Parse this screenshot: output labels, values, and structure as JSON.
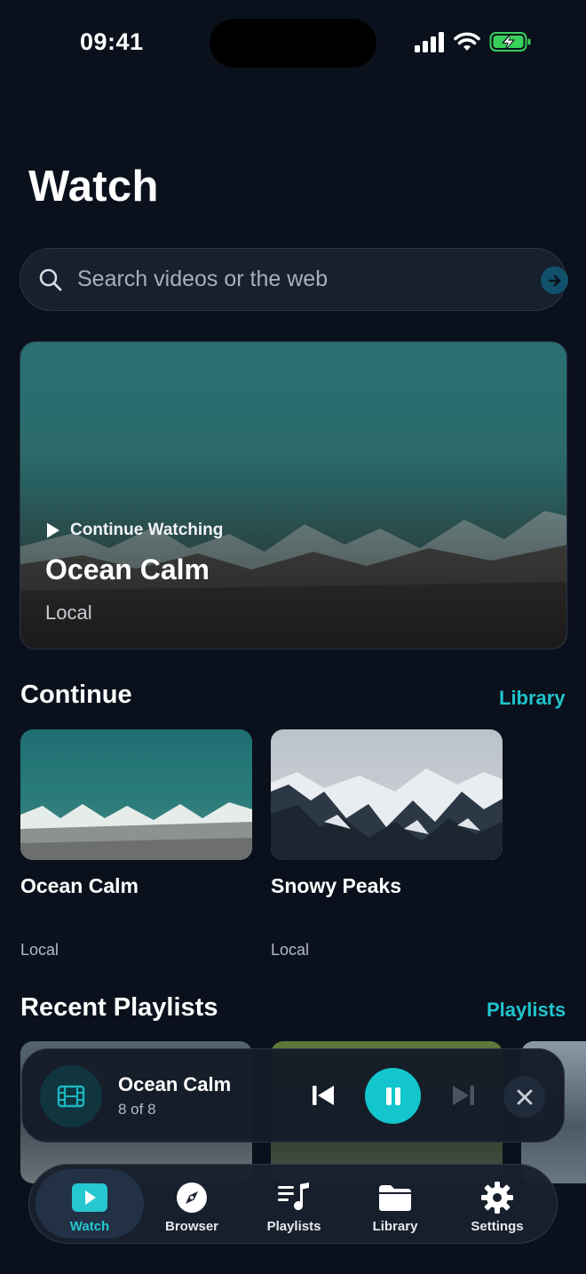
{
  "status_bar": {
    "time": "09:41"
  },
  "header": {
    "title": "Watch"
  },
  "search": {
    "placeholder": "Search videos or the web"
  },
  "hero": {
    "eyebrow": "Continue Watching",
    "title": "Ocean Calm",
    "subtitle": "Local"
  },
  "continue_section": {
    "title": "Continue",
    "link": "Library",
    "items": [
      {
        "title": "Ocean Calm",
        "source": "Local"
      },
      {
        "title": "Snowy Peaks",
        "source": "Local"
      }
    ]
  },
  "playlists_section": {
    "title": "Recent Playlists",
    "link": "Playlists"
  },
  "mini_player": {
    "title": "Ocean Calm",
    "position": "8 of 8"
  },
  "tabs": [
    {
      "label": "Watch",
      "icon": "play-square-icon",
      "active": true
    },
    {
      "label": "Browser",
      "icon": "compass-icon",
      "active": false
    },
    {
      "label": "Playlists",
      "icon": "music-list-icon",
      "active": false
    },
    {
      "label": "Library",
      "icon": "folder-icon",
      "active": false
    },
    {
      "label": "Settings",
      "icon": "gear-icon",
      "active": false
    }
  ],
  "colors": {
    "accent": "#20c3cc",
    "background": "#0b111c",
    "surface": "#17202f"
  }
}
